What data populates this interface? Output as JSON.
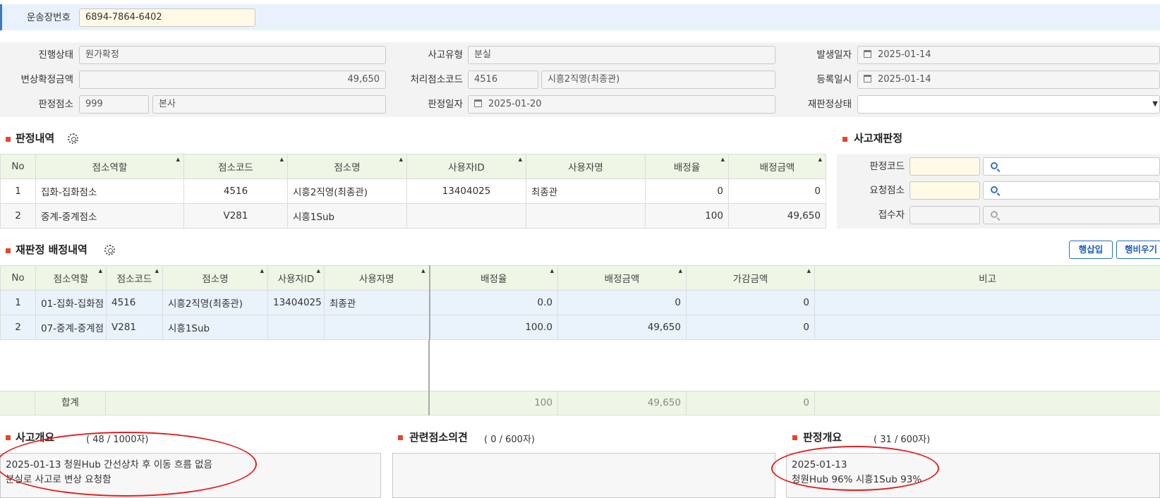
{
  "waybill": {
    "label": "운송장번호",
    "value": "6894-7864-6402"
  },
  "info": {
    "status_label": "진행상태",
    "status_value": "원가확정",
    "accident_type_label": "사고유형",
    "accident_type_value": "분실",
    "occur_date_label": "발생일자",
    "occur_date_value": "2025-01-14",
    "comp_amount_label": "변상확정금액",
    "comp_amount_value": "49,650",
    "proc_code_label": "처리점소코드",
    "proc_code_value": "4516",
    "proc_name_value": "시흥2직영(최종관)",
    "reg_date_label": "등록일시",
    "reg_date_value": "2025-01-14",
    "judge_office_label": "판정점소",
    "judge_office_code": "999",
    "judge_office_name": "본사",
    "judge_date_label": "판정일자",
    "judge_date_value": "2025-01-20",
    "rejudge_status_label": "재판정상태",
    "rejudge_status_value": ""
  },
  "judgment": {
    "title": "판정내역",
    "headers": [
      "No",
      "점소역할",
      "점소코드",
      "점소명",
      "사용자ID",
      "사용자명",
      "배정율",
      "배정금액"
    ],
    "rows": [
      [
        "1",
        "집화-집화점소",
        "4516",
        "시흥2직영(최종관)",
        "13404025",
        "최종관",
        "0",
        "0"
      ],
      [
        "2",
        "중계-중계점소",
        "V281",
        "시흥1Sub",
        "",
        "",
        "100",
        "49,650"
      ]
    ]
  },
  "rejudge_panel": {
    "title": "사고재판정",
    "judge_code_label": "판정코드",
    "req_office_label": "요청점소",
    "receiver_label": "접수자"
  },
  "reassign": {
    "title": "재판정 배정내역",
    "add_row": "행삽입",
    "clear_row": "행비우기",
    "headers": [
      "No",
      "점소역할",
      "점소코드",
      "점소명",
      "사용자ID",
      "사용자명",
      "배정율",
      "배정금액",
      "가감금액",
      "비고"
    ],
    "rows": [
      [
        "1",
        "01-집화-집화점",
        "4516",
        "시흥2직영(최종관)",
        "13404025",
        "최종관",
        "0.0",
        "0",
        "0",
        ""
      ],
      [
        "2",
        "07-중계-중계점",
        "V281",
        "시흥1Sub",
        "",
        "",
        "100.0",
        "49,650",
        "0",
        ""
      ]
    ],
    "total_label": "합계",
    "total_rate": "100",
    "total_amount": "49,650",
    "total_adjust": "0"
  },
  "summary": {
    "title": "사고개요",
    "count": "( 48 / 1000자)",
    "text_line1": "2025-01-13 청원Hub 간선상차 후 이동 흐름 없음",
    "text_line2": "분실로 사고로 변상 요청함"
  },
  "opinion": {
    "title": "관련점소의견",
    "count": "( 0 / 600자)"
  },
  "judge_summary": {
    "title": "판정개요",
    "count": "( 31 / 600자)",
    "text_line1": "2025-01-13",
    "text_line2": "청원Hub 96% 시흥1Sub 93%"
  },
  "colors": {
    "accent_red": "#e8452c",
    "header_green": "#eef6e5",
    "row_blue": "#eaf3fc",
    "button_blue": "#2d6dc2"
  }
}
